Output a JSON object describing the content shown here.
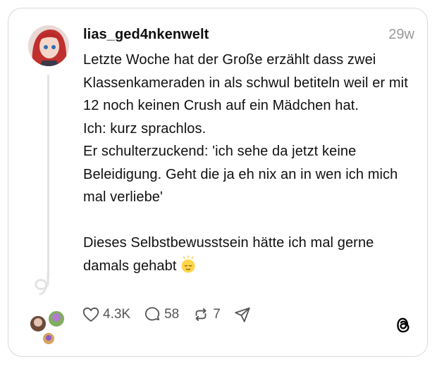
{
  "post": {
    "username": "lias_ged4nkenwelt",
    "time": "29w",
    "text": "Letzte Woche hat der Große erzählt dass zwei Klassenkameraden in als schwul betiteln weil er mit 12 noch keinen Crush auf ein Mädchen hat.\nIch: kurz sprachlos.\nEr schulterzuckend: 'ich sehe da jetzt keine Beleidigung. Geht die ja eh nix an in wen ich mich mal verliebe'\n\nDieses Selbstbewusstsein hätte ich mal gerne damals gehabt",
    "emoji": "relieved-face"
  },
  "actions": {
    "likes": "4.3K",
    "replies": "58",
    "reposts": "7"
  },
  "icons": [
    "heart-icon",
    "comment-icon",
    "repost-icon",
    "send-icon",
    "threads-logo-icon"
  ]
}
